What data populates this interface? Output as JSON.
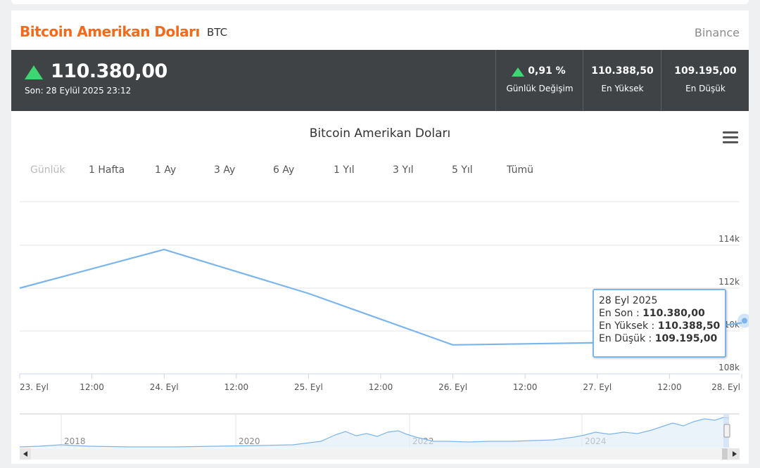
{
  "header": {
    "title": "Bitcoin Amerikan Doları",
    "code": "BTC",
    "exchange": "Binance"
  },
  "price": {
    "last": "110.380,00",
    "last_time": "Son: 28 Eylül 2025 23:12",
    "change_value": "0,91 %",
    "change_label": "Günlük Değişim",
    "high_value": "110.388,50",
    "high_label": "En Yüksek",
    "low_value": "109.195,00",
    "low_label": "En Düşük",
    "up_color": "#3ed672"
  },
  "chart": {
    "title": "Bitcoin Amerikan Doları",
    "menu_icon": "hamburger-icon",
    "ranges": [
      "Günlük",
      "1 Hafta",
      "1 Ay",
      "3 Ay",
      "6 Ay",
      "1 Yıl",
      "3 Yıl",
      "5 Yıl",
      "Tümü"
    ],
    "tooltip": {
      "date": "28 Eyl 2025",
      "rows": [
        {
          "label": "En Son : ",
          "value": "110.380,00"
        },
        {
          "label": "En Yüksek : ",
          "value": "110.388,50"
        },
        {
          "label": "En Düşük : ",
          "value": "109.195,00"
        }
      ]
    }
  },
  "chart_data": {
    "type": "line",
    "title": "Bitcoin Amerikan Doları",
    "x": [
      "23. Eyl",
      "24. Eyl",
      "25. Eyl",
      "26. Eyl",
      "27. Eyl",
      "28. Eyl"
    ],
    "x_tick_labels": [
      "23. Eyl",
      "12:00",
      "24. Eyl",
      "12:00",
      "25. Eyl",
      "12:00",
      "26. Eyl",
      "12:00",
      "27. Eyl",
      "12:00",
      "28. Eyl"
    ],
    "series": [
      {
        "values": [
          112000,
          113800,
          111750,
          109350,
          109450,
          110380
        ]
      }
    ],
    "y_tick_labels": [
      "108k",
      "110k",
      "112k",
      "114k"
    ],
    "ylim": [
      108000,
      114000
    ],
    "grid": true,
    "line_color": "#7cb5ec",
    "navigator": {
      "year_labels": [
        "2018",
        "2020",
        "2022",
        "2024"
      ]
    }
  }
}
